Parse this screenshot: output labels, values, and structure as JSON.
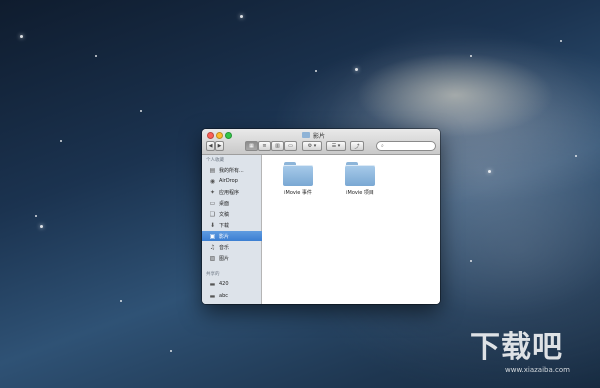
{
  "window": {
    "title": "影片",
    "nav": {
      "back": "◀",
      "forward": "▶"
    },
    "view_modes": [
      "icon-view",
      "list-view",
      "column-view",
      "coverflow-view"
    ],
    "action_menu": "⚙ ▾",
    "arrange_menu": "☰ ▾",
    "share": "⤴",
    "search_placeholder": ""
  },
  "sidebar": {
    "section_favorites": "个人收藏",
    "favorites": [
      {
        "label": "我的所有...",
        "icon": "all-files-icon"
      },
      {
        "label": "AirDrop",
        "icon": "airdrop-icon"
      },
      {
        "label": "应用程序",
        "icon": "applications-icon"
      },
      {
        "label": "桌面",
        "icon": "desktop-icon"
      },
      {
        "label": "文稿",
        "icon": "documents-icon"
      },
      {
        "label": "下载",
        "icon": "downloads-icon"
      },
      {
        "label": "影片",
        "icon": "movies-icon",
        "selected": true
      },
      {
        "label": "音乐",
        "icon": "music-icon"
      },
      {
        "label": "图片",
        "icon": "pictures-icon"
      }
    ],
    "section_devices": "共享的",
    "devices": [
      {
        "label": "420",
        "icon": "disk-icon"
      },
      {
        "label": "abc",
        "icon": "disk-icon"
      }
    ]
  },
  "files": [
    {
      "name": "iMovie 事件",
      "icon": "folder-icon"
    },
    {
      "name": "iMovie 项目",
      "icon": "folder-icon"
    }
  ],
  "watermark": {
    "text": "下载吧",
    "url": "www.xiazaiba.com"
  },
  "colors": {
    "selection": "#3b7ed2",
    "folder": "#8db5d9",
    "sidebar_bg": "#dde3ea"
  }
}
